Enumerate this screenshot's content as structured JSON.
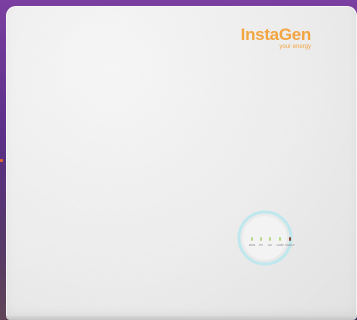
{
  "brand": {
    "name": "InstaGen",
    "tagline": "your energy",
    "color": "#f2a541"
  },
  "status_panel": {
    "ring_color": "#bfe7ee",
    "indicators": [
      {
        "label": "RUN",
        "color": "#b9d98a"
      },
      {
        "label": "PV",
        "color": "#b9d98a"
      },
      {
        "label": "AC",
        "color": "#b9d98a"
      },
      {
        "label": "COM",
        "color": "#b9d98a"
      },
      {
        "label": "FAULT",
        "color": "#8a4a3a"
      }
    ]
  }
}
